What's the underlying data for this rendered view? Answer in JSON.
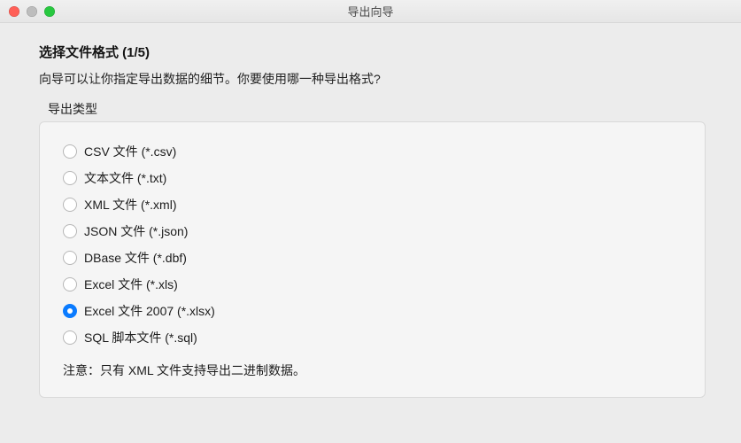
{
  "window": {
    "title": "导出向导"
  },
  "wizard": {
    "heading": "选择文件格式 (1/5)",
    "subheading": "向导可以让你指定导出数据的细节。你要使用哪一种导出格式?",
    "group_label": "导出类型",
    "note": "注意：只有 XML 文件支持导出二进制数据。"
  },
  "export_types": [
    {
      "label": "CSV 文件 (*.csv)",
      "selected": false
    },
    {
      "label": "文本文件 (*.txt)",
      "selected": false
    },
    {
      "label": "XML 文件 (*.xml)",
      "selected": false
    },
    {
      "label": "JSON 文件 (*.json)",
      "selected": false
    },
    {
      "label": "DBase 文件 (*.dbf)",
      "selected": false
    },
    {
      "label": "Excel 文件 (*.xls)",
      "selected": false
    },
    {
      "label": "Excel 文件 2007 (*.xlsx)",
      "selected": true
    },
    {
      "label": "SQL 脚本文件 (*.sql)",
      "selected": false
    }
  ]
}
